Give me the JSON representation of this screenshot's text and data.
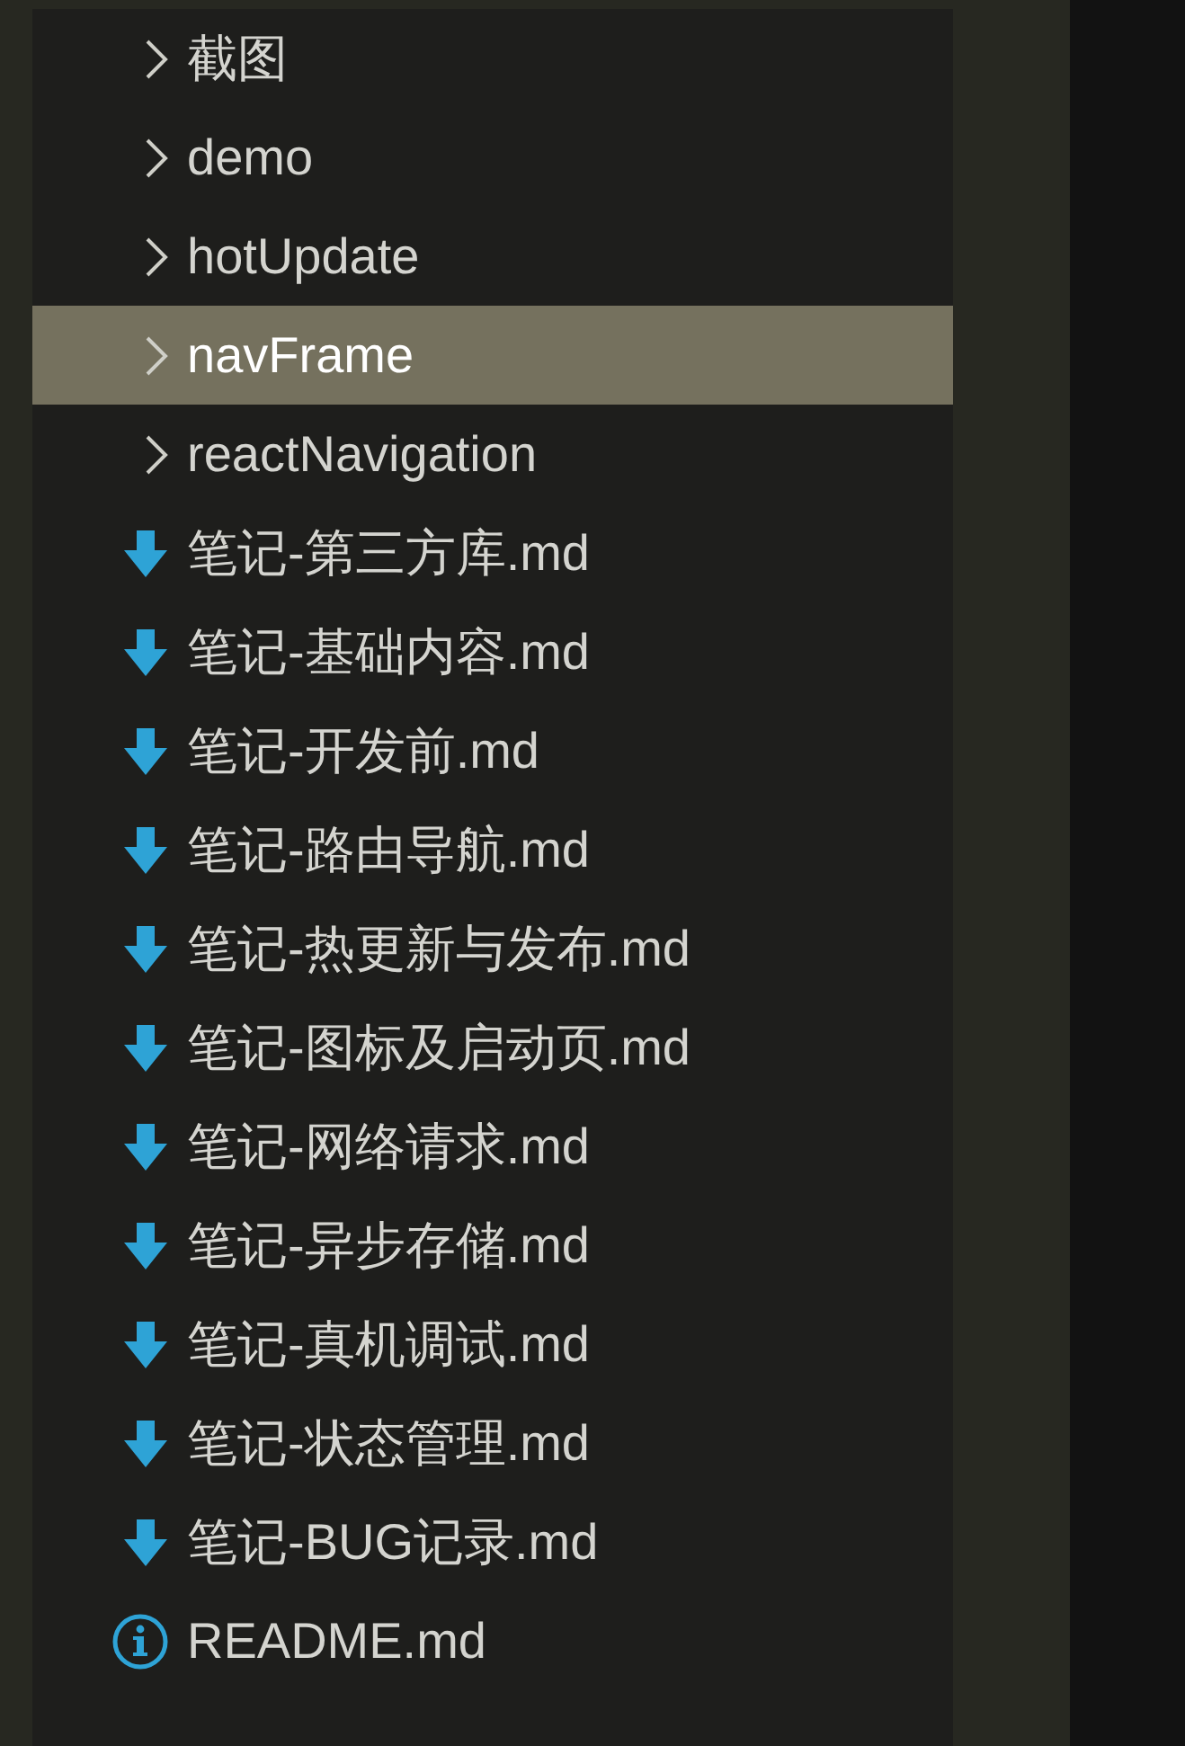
{
  "explorer": {
    "items": [
      {
        "kind": "folder",
        "name": "截图",
        "selected": false
      },
      {
        "kind": "folder",
        "name": "demo",
        "selected": false
      },
      {
        "kind": "folder",
        "name": "hotUpdate",
        "selected": false
      },
      {
        "kind": "folder",
        "name": "navFrame",
        "selected": true
      },
      {
        "kind": "folder",
        "name": "reactNavigation",
        "selected": false
      },
      {
        "kind": "markdown",
        "name": "笔记-第三方库.md",
        "selected": false
      },
      {
        "kind": "markdown",
        "name": "笔记-基础内容.md",
        "selected": false
      },
      {
        "kind": "markdown",
        "name": "笔记-开发前.md",
        "selected": false
      },
      {
        "kind": "markdown",
        "name": "笔记-路由导航.md",
        "selected": false
      },
      {
        "kind": "markdown",
        "name": "笔记-热更新与发布.md",
        "selected": false
      },
      {
        "kind": "markdown",
        "name": "笔记-图标及启动页.md",
        "selected": false
      },
      {
        "kind": "markdown",
        "name": "笔记-网络请求.md",
        "selected": false
      },
      {
        "kind": "markdown",
        "name": "笔记-异步存储.md",
        "selected": false
      },
      {
        "kind": "markdown",
        "name": "笔记-真机调试.md",
        "selected": false
      },
      {
        "kind": "markdown",
        "name": "笔记-状态管理.md",
        "selected": false
      },
      {
        "kind": "markdown",
        "name": "笔记-BUG记录.md",
        "selected": false
      },
      {
        "kind": "info",
        "name": "README.md",
        "selected": false
      }
    ]
  }
}
